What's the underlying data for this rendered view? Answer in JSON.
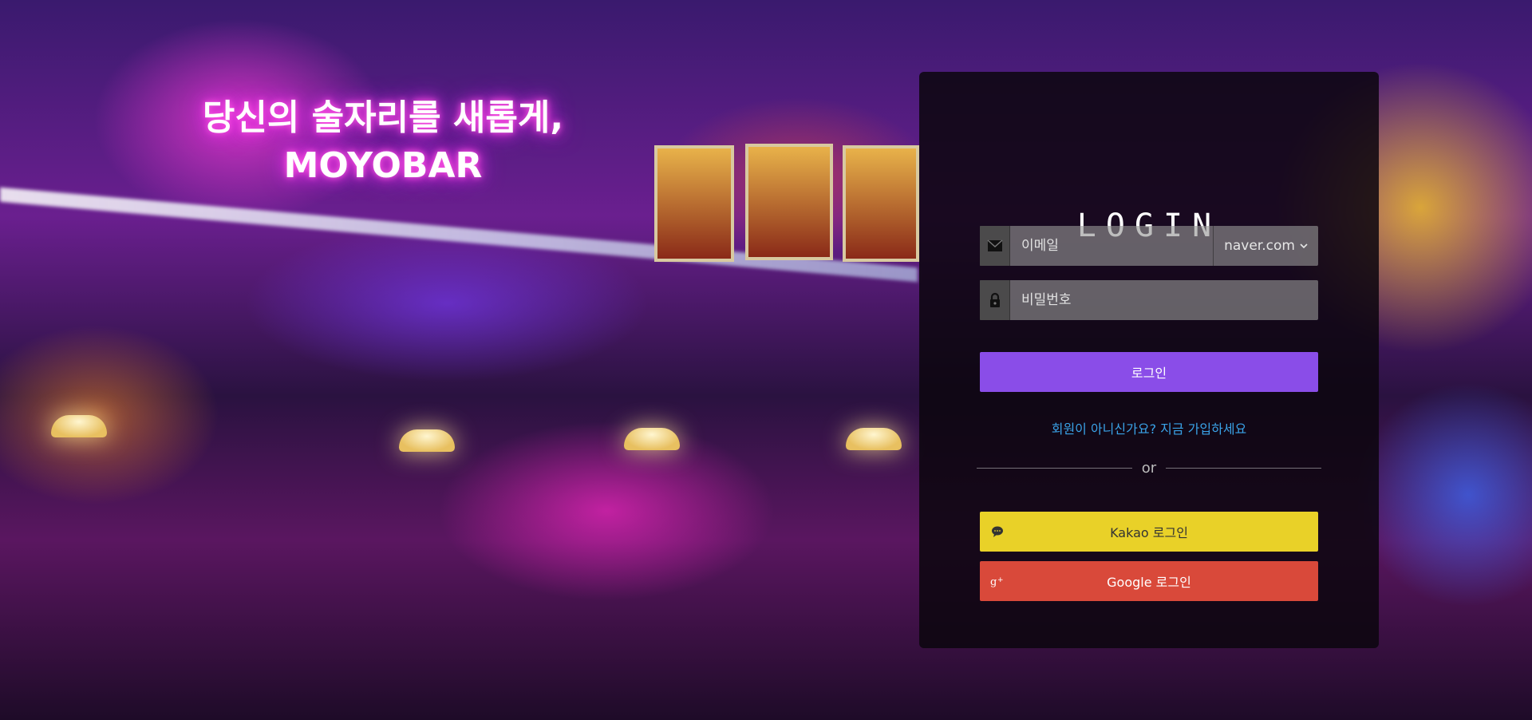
{
  "hero": {
    "line1": "당신의 술자리를 새롭게,",
    "line2": "MOYOBAR"
  },
  "login": {
    "title": "LOGIN",
    "email_placeholder": "이메일",
    "email_domain": "naver.com",
    "password_placeholder": "비밀번호",
    "submit_label": "로그인",
    "signup_link": "회원이 아니신가요? 지금 가입하세요",
    "divider_text": "or",
    "kakao_label": "Kakao 로그인",
    "google_label": "Google 로그인"
  },
  "colors": {
    "login_button": "#8a4de8",
    "kakao_button": "#e9d128",
    "google_button": "#d9493a",
    "signup_link": "#3aa3e8",
    "neon_glow": "#ff39d8"
  },
  "icons": {
    "email": "envelope-icon",
    "password": "lock-icon",
    "domain_dropdown": "chevron-down-icon",
    "kakao": "speech-bubble-icon",
    "google": "google-plus-icon"
  }
}
